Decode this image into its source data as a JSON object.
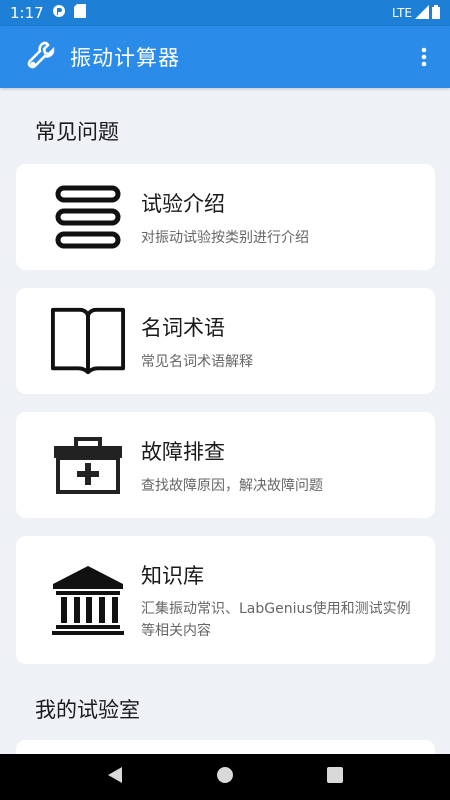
{
  "status_bar": {
    "time": "1:17",
    "network": "LTE"
  },
  "app_bar": {
    "title": "振动计算器"
  },
  "sections": {
    "faq_title": "常见问题",
    "lab_title": "我的试验室"
  },
  "cards": [
    {
      "title": "试验介绍",
      "desc": "对振动试验按类别进行介绍",
      "icon": "list-icon"
    },
    {
      "title": "名词术语",
      "desc": "常见名词术语解释",
      "icon": "book-icon"
    },
    {
      "title": "故障排查",
      "desc": "查找故障原因，解决故障问题",
      "icon": "toolbox-icon"
    },
    {
      "title": "知识库",
      "desc": "汇集振动常识、LabGenius使用和测试实例等相关内容",
      "icon": "library-icon"
    }
  ]
}
